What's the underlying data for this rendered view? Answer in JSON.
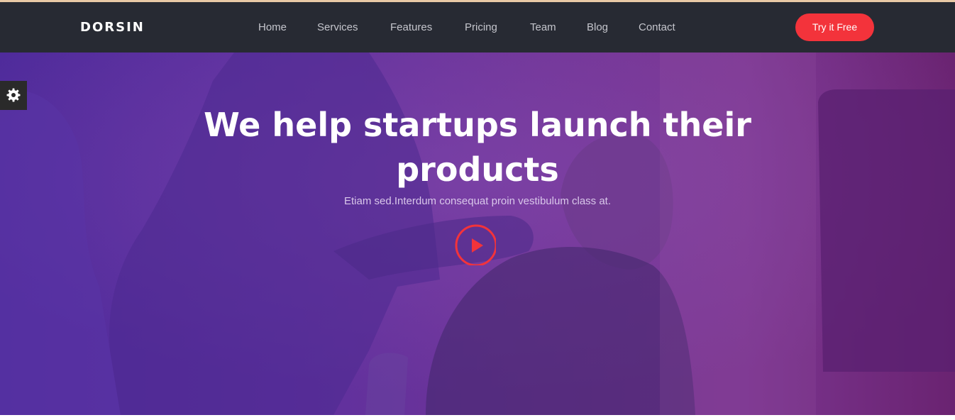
{
  "brand": {
    "logo_text": "DORSIN"
  },
  "nav": {
    "items": [
      {
        "label": "Home"
      },
      {
        "label": "Services"
      },
      {
        "label": "Features"
      },
      {
        "label": "Pricing"
      },
      {
        "label": "Team"
      },
      {
        "label": "Blog"
      },
      {
        "label": "Contact"
      }
    ],
    "cta_label": "Try it Free"
  },
  "hero": {
    "title": "We help startups launch their products",
    "subtitle": "Etiam sed.Interdum consequat proin vestibulum class at.",
    "play_icon": "play-circle-icon"
  },
  "settings": {
    "icon": "gear-icon"
  },
  "colors": {
    "navbar_bg": "#272a33",
    "accent": "#f3333b",
    "hero_gradient_start": "#4f2b9b",
    "hero_gradient_end": "#6a2371"
  }
}
